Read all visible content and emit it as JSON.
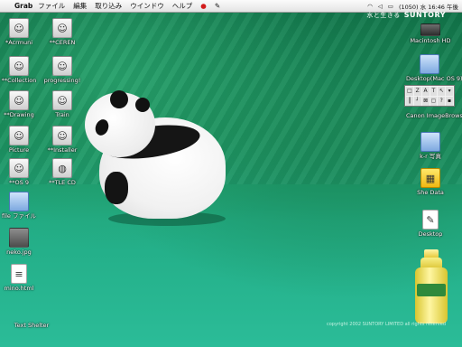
{
  "menubar": {
    "app": "Grab",
    "menus": [
      "ファイル",
      "編集",
      "取り込み",
      "ウインドウ",
      "ヘルプ"
    ],
    "status_right": "(1050)  水 16:46 午後"
  },
  "brand": {
    "text": "水と生きる",
    "name": "SUNTORY"
  },
  "left_icons": [
    {
      "name": "*Acrmuni",
      "icon": "avatar-icon"
    },
    {
      "name": "**CEREN",
      "icon": "avatar-icon"
    },
    {
      "name": "**Collection",
      "icon": "avatar-icon"
    },
    {
      "name": "progressing!",
      "icon": "avatar-icon"
    },
    {
      "name": "**Drawing",
      "icon": "avatar-icon"
    },
    {
      "name": "Train",
      "icon": "avatar-icon"
    },
    {
      "name": "Picture",
      "icon": "avatar-icon"
    },
    {
      "name": "**Installer",
      "icon": "avatar-icon"
    },
    {
      "name": "**OS 9",
      "icon": "avatar-icon"
    },
    {
      "name": "**TLE CD",
      "icon": "avatar-icon"
    },
    {
      "name": "file ファイル",
      "icon": "folder-icon"
    },
    {
      "name": "neko.jpg",
      "icon": "photo-icon"
    },
    {
      "name": "mino.html",
      "icon": "document-icon"
    },
    {
      "name": "Text Shelter",
      "icon": "document-icon"
    }
  ],
  "right_icons": [
    {
      "name": "Macintosh HD",
      "icon": "hard-drive-icon"
    },
    {
      "name": "Desktop(Mac OS 9)",
      "icon": "folder-icon"
    },
    {
      "name": "Canon ImageBrowser",
      "icon": "camera-icon"
    },
    {
      "name": "k-r 写真",
      "icon": "folder-icon"
    },
    {
      "name": "She Data",
      "icon": "lego-icon"
    },
    {
      "name": "Desktop",
      "icon": "document-icon"
    }
  ],
  "palette": {
    "buttons": [
      "□",
      "Z",
      "A",
      "T",
      "↖",
      "▾",
      "┃",
      "┘",
      "⊠",
      "▢",
      "?",
      "▪"
    ]
  },
  "footer": "copyright 2002 SUNTORY LIMITED all rights reserved"
}
